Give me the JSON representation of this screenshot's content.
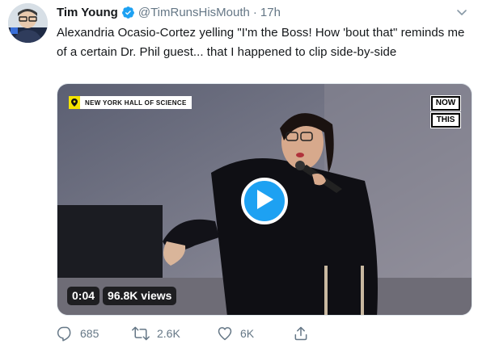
{
  "tweet": {
    "author": {
      "display_name": "Tim Young",
      "handle": "@TimRunsHisMouth",
      "verified": true,
      "avatar_icon": "avatar-photo"
    },
    "separator": "·",
    "timestamp": "17h",
    "text": "Alexandria Ocasio-Cortez yelling \"I'm the Boss! How 'bout that\" reminds me of a certain Dr. Phil guest... that I happened to clip side-by-side",
    "media": {
      "location_label": "NEW YORK HALL OF SCIENCE",
      "logo_lines": [
        "NOW",
        "THIS"
      ],
      "duration": "0:04",
      "views": "96.8K views",
      "play_icon": "play-icon"
    },
    "actions": {
      "reply": {
        "icon": "reply-icon",
        "count": "685"
      },
      "retweet": {
        "icon": "retweet-icon",
        "count": "2.6K"
      },
      "like": {
        "icon": "heart-icon",
        "count": "6K"
      },
      "share": {
        "icon": "share-icon"
      }
    }
  },
  "colors": {
    "accent": "#1da1f2",
    "muted": "#657786",
    "text": "#14171a",
    "badge_yellow": "#f5e400"
  }
}
